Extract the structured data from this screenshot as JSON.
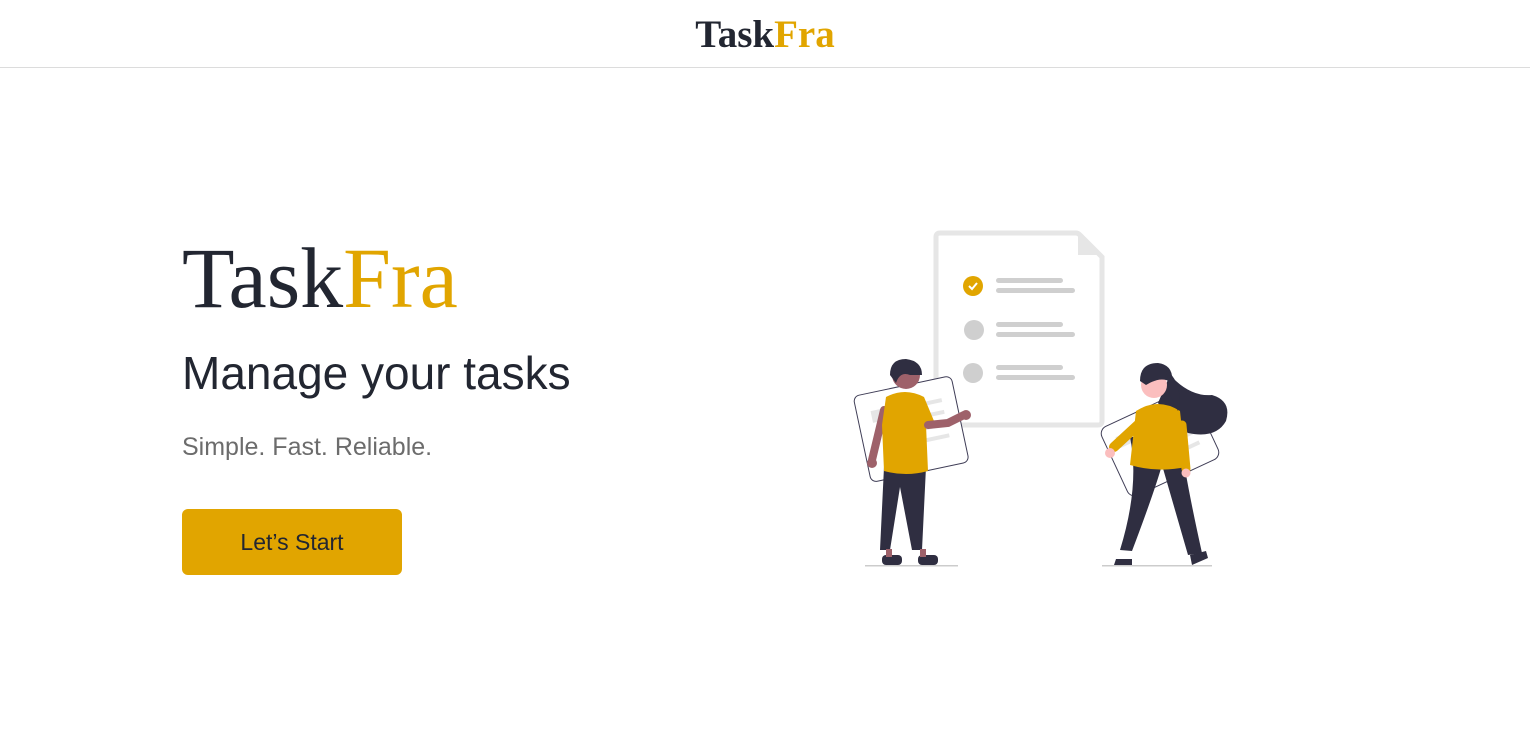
{
  "navbar": {
    "brand_part1": "Task",
    "brand_part2": "Fra"
  },
  "hero": {
    "brand_part1": "Task",
    "brand_part2": "Fra",
    "title": "Manage your tasks",
    "tagline": "Simple. Fast. Reliable.",
    "cta_label": "Let’s Start"
  },
  "colors": {
    "accent": "#e1a500",
    "dark": "#222631",
    "muted_text": "#6c6c6c",
    "border": "#dcdcdc"
  },
  "illustration": {
    "icon": "task-checklist-illustration",
    "checklist_items": [
      {
        "state": "checked"
      },
      {
        "state": "unchecked"
      },
      {
        "state": "unchecked"
      }
    ]
  }
}
